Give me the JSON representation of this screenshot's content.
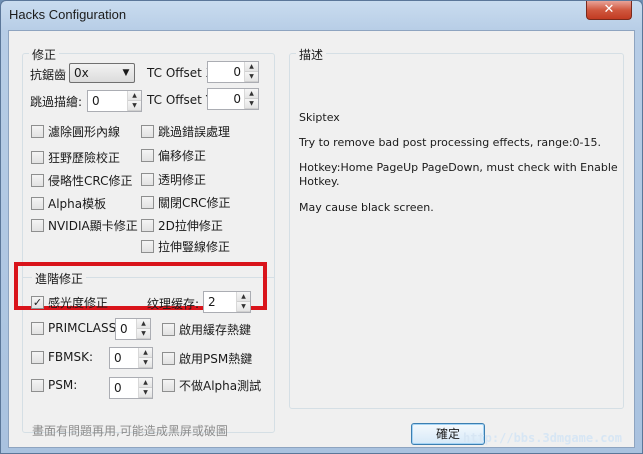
{
  "window": {
    "title": "Hacks Configuration",
    "close_glyph": "✕"
  },
  "fix_group": {
    "title": "修正",
    "aa_label": "抗鋸齒",
    "aa_value": "0x",
    "skip_draw_label": "跳過描繪:",
    "skip_draw_value": "0",
    "tc_offset_x_label": "TC Offset X",
    "tc_offset_x_value": "0",
    "tc_offset_y_label": "TC Offset Y",
    "tc_offset_y_value": "0",
    "left_checks": [
      "濾除圓形內線",
      "狂野歷險校正",
      "侵略性CRC修正",
      "Alpha模板",
      "NVIDIA顯卡修正"
    ],
    "right_checks": [
      "跳過錯誤處理",
      "偏移修正",
      "透明修正",
      "關閉CRC修正",
      "2D拉伸修正",
      "拉伸豎線修正"
    ]
  },
  "advanced_group": {
    "title": "進階修正",
    "sensitivity_label": "感光度修正",
    "sensitivity_checked": true,
    "texture_cache_label": "纹理缓存:",
    "texture_cache_value": "2",
    "rows": [
      {
        "label": "PRIMCLASS:",
        "value": "0",
        "check": "啟用緩存熱鍵"
      },
      {
        "label": "FBMSK:",
        "value": "0",
        "check": "啟用PSM熱鍵"
      },
      {
        "label": "PSM:",
        "value": "0",
        "check": "不做Alpha測試"
      }
    ]
  },
  "description_group": {
    "title": "描述",
    "lines": [
      "Skiptex",
      "Try to remove bad post processing effects, range:0-15.",
      "Hotkey:Home    PageUp    PageDown, must check with Enable Hotkey.",
      "May cause black screen."
    ]
  },
  "footer": {
    "hint": "畫面有問題再用,可能造成黑屏或破圖",
    "ok_label": "確定",
    "watermark": "http://bbs.3dmgame.com"
  },
  "check_glyph": "✓"
}
